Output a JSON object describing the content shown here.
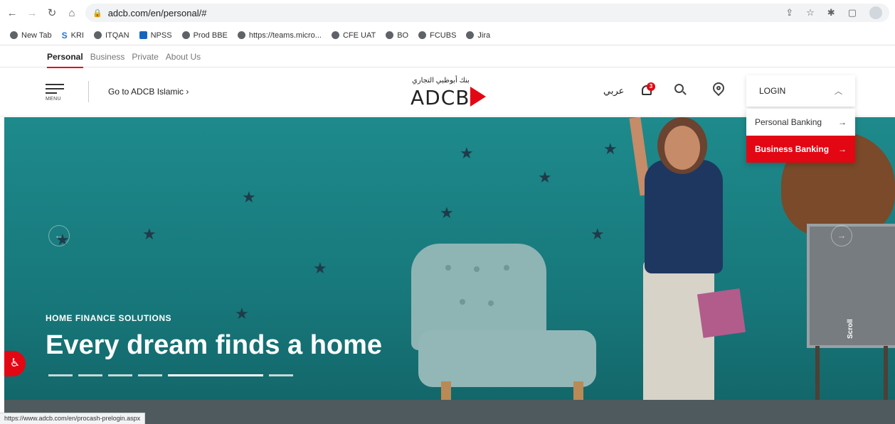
{
  "browser": {
    "url": "adcb.com/en/personal/#",
    "status_url": "https://www.adcb.com/en/procash-prelogin.aspx"
  },
  "bookmarks": [
    "New Tab",
    "KRI",
    "ITQAN",
    "NPSS",
    "Prod BBE",
    "https://teams.micro...",
    "CFE UAT",
    "BO",
    "FCUBS",
    "Jira"
  ],
  "site_tabs": [
    "Personal",
    "Business",
    "Private",
    "About Us"
  ],
  "header": {
    "menu_label": "MENU",
    "goto_label": "Go to  ADCB Islamic  ›",
    "logo_arabic": "بنك أبوظبي التجاري",
    "logo_text": "ADCB",
    "lang_toggle": "عربي",
    "notification_count": "3",
    "login_label": "LOGIN"
  },
  "login_dropdown": {
    "items": [
      "Personal Banking",
      "Business Banking"
    ]
  },
  "hero": {
    "eyebrow": "HOME FINANCE SOLUTIONS",
    "headline": "Every dream finds a home",
    "scroll_label": "Scroll"
  },
  "colors": {
    "brand_red": "#e30613",
    "hero_teal": "#1e8a8c"
  }
}
